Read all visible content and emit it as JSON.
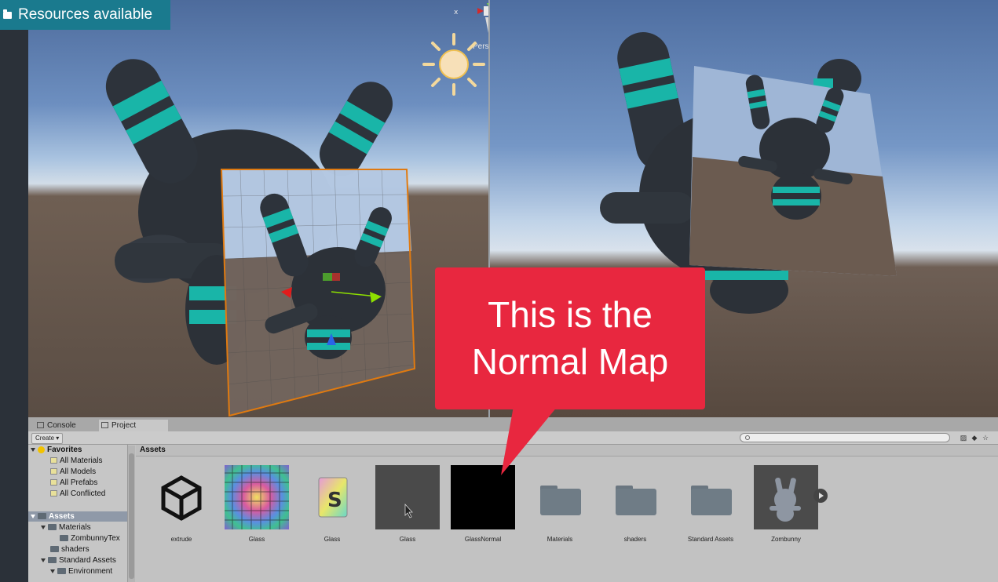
{
  "overlay": {
    "resources_label": "Resources available"
  },
  "scene": {
    "projection_label": "Persp"
  },
  "callout": {
    "line1": "This is the",
    "line2": "Normal Map"
  },
  "panel": {
    "tabs": [
      {
        "label": "Console"
      },
      {
        "label": "Project"
      }
    ],
    "create_label": "Create ▾",
    "search": {
      "value": ""
    },
    "favorites": {
      "label": "Favorites",
      "items": [
        "All Materials",
        "All Models",
        "All Prefabs",
        "All Conflicted"
      ]
    },
    "tree": {
      "assets_label": "Assets",
      "materials_label": "Materials",
      "zombunny_tex_label": "ZombunnyTex",
      "shaders_label": "shaders",
      "standard_assets_label": "Standard Assets",
      "environment_label": "Environment"
    },
    "assets_header": "Assets",
    "assets": [
      {
        "name": "extrude",
        "type": "unity-scene"
      },
      {
        "name": "Glass",
        "type": "texture"
      },
      {
        "name": "Glass",
        "type": "shader"
      },
      {
        "name": "Glass",
        "type": "material"
      },
      {
        "name": "GlassNormal",
        "type": "normal-map"
      },
      {
        "name": "Materials",
        "type": "folder"
      },
      {
        "name": "shaders",
        "type": "folder"
      },
      {
        "name": "Standard Assets",
        "type": "folder"
      },
      {
        "name": "Zombunny",
        "type": "model"
      }
    ]
  },
  "colors": {
    "callout": "#e8273f",
    "banner": "#1a7a8e",
    "stripe": "#19c2b4"
  }
}
